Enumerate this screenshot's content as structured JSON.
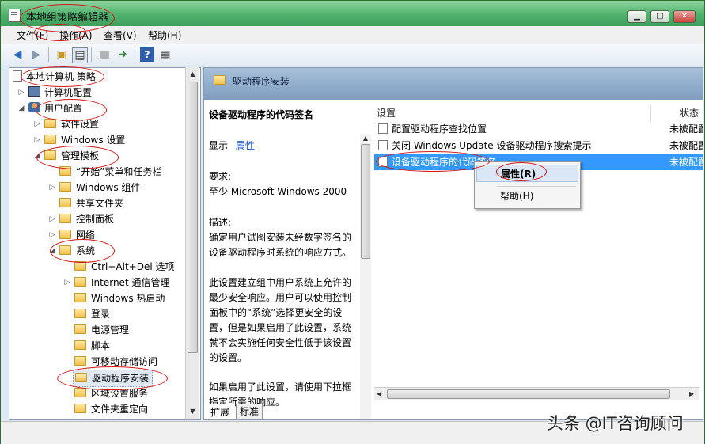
{
  "window": {
    "title": "本地组策略编辑器",
    "controls": [
      "minimize",
      "maximize",
      "close"
    ]
  },
  "menu": [
    "文件(F)",
    "操作(A)",
    "查看(V)",
    "帮助(H)"
  ],
  "toolbar": {
    "icons": [
      "back-arrow-icon",
      "forward-arrow-icon",
      "up-folder-icon",
      "show-hide-tree-icon",
      "properties-icon",
      "export-list-icon",
      "help-icon",
      "filter-icon"
    ]
  },
  "tree": {
    "root": "本地计算机 策略",
    "computer_config": "计算机配置",
    "user_config": "用户配置",
    "software_settings": "软件设置",
    "windows_settings": "Windows 设置",
    "admin_templates": "管理模板",
    "start_menu": "“开始”菜单和任务栏",
    "windows_components": "Windows 组件",
    "shared_folders": "共享文件夹",
    "control_panel": "控制面板",
    "network": "网络",
    "system": "系统",
    "system_children": [
      "Ctrl+Alt+Del 选项",
      "Internet 通信管理",
      "Windows 热启动",
      "登录",
      "电源管理",
      "脚本",
      "可移动存储访问",
      "驱动程序安装",
      "区域设置服务",
      "文件夹重定向"
    ]
  },
  "right_header": {
    "title": "驱动程序安装"
  },
  "description": {
    "title": "设备驱动程序的代码签名",
    "show_label": "显示",
    "properties_link": "属性",
    "requirements_label": "要求:",
    "requirements_value": "至少 Microsoft Windows 2000",
    "desc_label": "描述:",
    "desc_p1": "确定用户试图安装未经数字签名的设备驱动程序时系统的响应方式。",
    "desc_p2": "此设置建立组中用户系统上允许的最少安全响应。用户可以使用控制面板中的“系统”选择更安全的设置，但是如果启用了此设置，系统就不会实施任何安全性低于该设置的设置。",
    "desc_p3": "如果启用了此设置，请使用下拉框指定所需的响应。"
  },
  "list": {
    "col_setting": "设置",
    "col_state": "状态",
    "rows": [
      {
        "name": "配置驱动程序查找位置",
        "state": "未被配置"
      },
      {
        "name": "关闭 Windows Update 设备驱动程序搜索提示",
        "state": "未被配置"
      },
      {
        "name": "设备驱动程序的代码签名",
        "state": "未被配置"
      }
    ]
  },
  "context_menu": [
    "属性(R)",
    "帮助(H)"
  ],
  "tabs": [
    "扩展",
    "标准"
  ],
  "watermark": "头条 @IT咨询顾问"
}
